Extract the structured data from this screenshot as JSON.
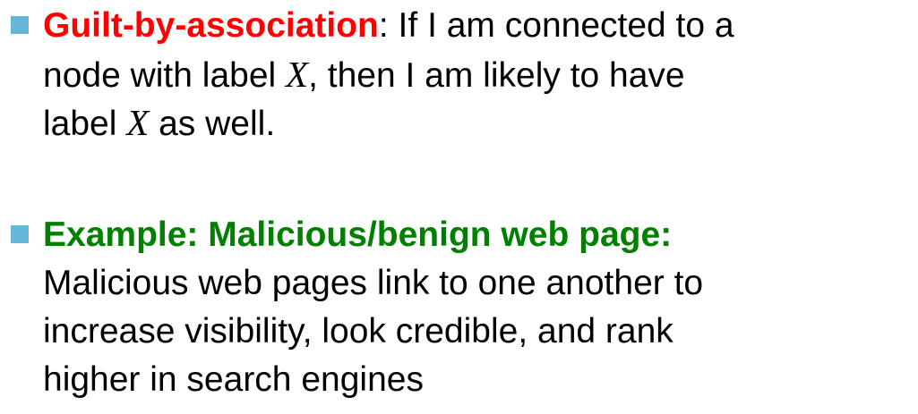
{
  "slide": {
    "bullets": [
      {
        "marker_color": "#67b6d8",
        "term": "Guilt-by-association",
        "term_color": "#ff0000",
        "lines": [
          {
            "after_term": ": If I am connected to a"
          },
          {
            "before_var": "node with label ",
            "var": "X",
            "after_var": ", then I am likely to have"
          },
          {
            "before_var": "label ",
            "var": "X",
            "after_var": " as well."
          }
        ]
      },
      {
        "marker_color": "#67b6d8",
        "term": "Example: Malicious/benign web page:",
        "term_color": "#008000",
        "lines": [
          {
            "text": "Malicious web pages link to one another to"
          },
          {
            "text": "increase visibility, look credible, and rank"
          },
          {
            "text": "higher in search engines"
          }
        ]
      }
    ]
  }
}
